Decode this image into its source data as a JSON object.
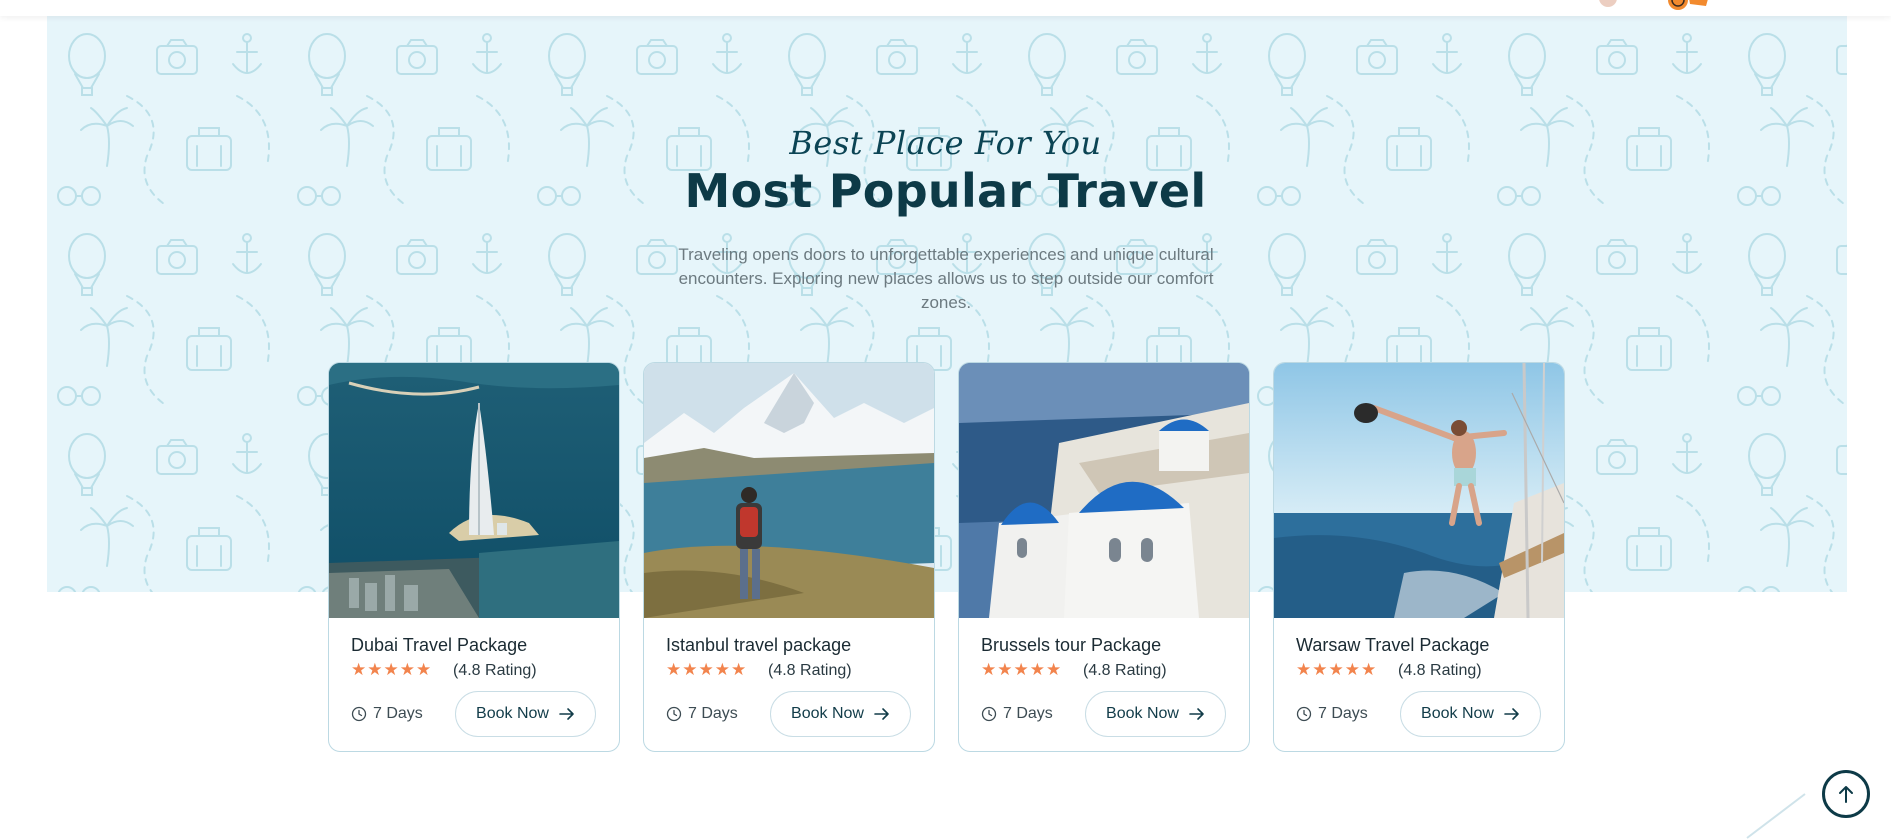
{
  "section": {
    "script_title": "Best Place For You",
    "title": "Most Popular Travel",
    "description": "Traveling opens doors to unforgettable experiences and unique cultural encounters. Exploring new places allows us to step outside our comfort zones."
  },
  "cards": [
    {
      "title": "Dubai Travel Package",
      "stars": "★★★★★",
      "rating_text": "(4.8 Rating)",
      "duration": "7 Days",
      "button": "Book Now",
      "image_icon": "dubai-burj-al-arab-image"
    },
    {
      "title": "Istanbul travel package",
      "stars": "★★★★★",
      "rating_text": "(4.8 Rating)",
      "duration": "7 Days",
      "button": "Book Now",
      "image_icon": "mountain-lake-hiker-image"
    },
    {
      "title": "Brussels tour Package",
      "stars": "★★★★★",
      "rating_text": "(4.8 Rating)",
      "duration": "7 Days",
      "button": "Book Now",
      "image_icon": "santorini-domes-image"
    },
    {
      "title": "Warsaw Travel Package",
      "stars": "★★★★★",
      "rating_text": "(4.8 Rating)",
      "duration": "7 Days",
      "button": "Book Now",
      "image_icon": "sailboat-jump-image"
    }
  ],
  "colors": {
    "hero_background": "#e6f5fa",
    "title_color": "#0d3a47",
    "star_color": "#f2844d",
    "card_border": "#bcd9e3"
  },
  "icons": {
    "clock": "clock-icon",
    "arrow": "arrow-right-icon",
    "scroll_top": "arrow-up-icon"
  }
}
